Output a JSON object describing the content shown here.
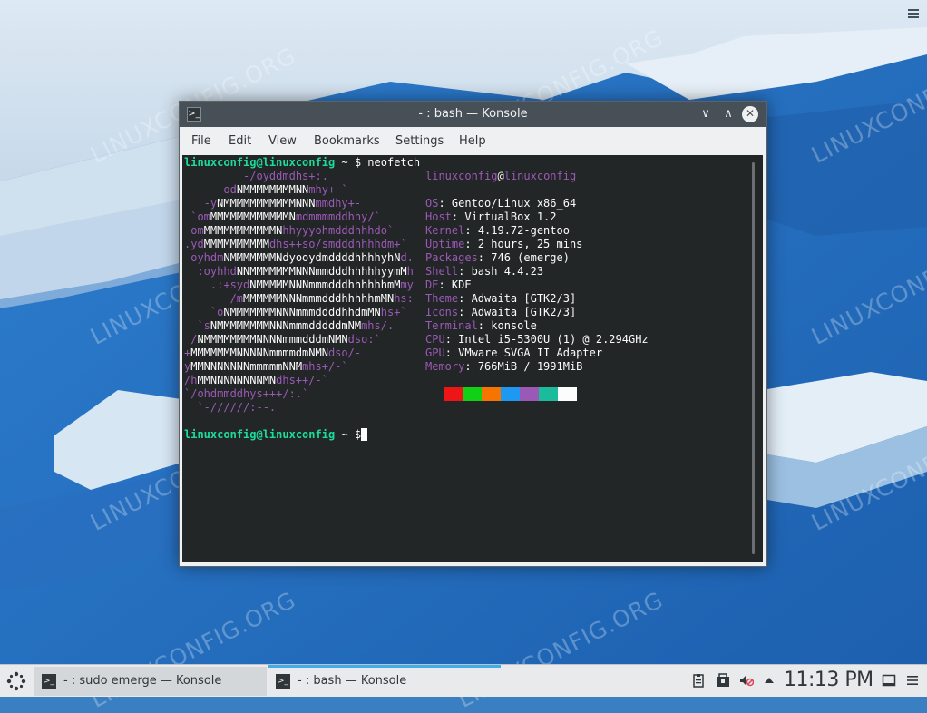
{
  "desktop": {
    "watermark_text": "LINUXCONFIG.ORG",
    "menu_icon": "hamburger-icon"
  },
  "window": {
    "title": "- : bash — Konsole",
    "app_icon": "terminal-icon",
    "buttons": {
      "minimize": "∨",
      "maximize": "∧",
      "close": "✕"
    },
    "menu": [
      "File",
      "Edit",
      "View",
      "Bookmarks",
      "Settings",
      "Help"
    ]
  },
  "terminal": {
    "prompt": "linuxconfig@linuxconfig",
    "prompt_suffix": " ~ $ ",
    "command": "neofetch",
    "logo": [
      "         -/oyddmdhs+:.",
      "     -odNMMMMMMMMNNmhy+-`",
      "   -yNMMMMMMMMMMMNNNmmdhy+-",
      " `omMMMMMMMMMMMMNmdmmmmddhhy/`",
      " omMMMMMMMMMMMNhhyyyohmdddhhhdo`",
      ".ydMMMMMMMMMMdhs++so/smdddhhhhdm+`",
      " oyhdmNMMMMMMMNdyooydmddddhhhhyhNd.",
      "  :oyhhdNNMMMMMMMNNNmmdddhhhhhyymMh",
      "    .:+sydNMMMMMNNNmmmdddhhhhhhmMmy",
      "       /mMMMMMMNNNmmmdddhhhhhmMNhs:",
      "    `oNMMMMMMMNNNmmmddddhhdmMNhs+`",
      "  `sNMMMMMMMMNNNmmmdddddmNMmhs/.",
      " /NMMMMMMMMNNNNmmmdddmNMNdso:`",
      "+MMMMMMMNNNNNmmmmdmNMNdso/-",
      "yMMNNNNNNNmmmmmNNMmhs+/-`",
      "/hMMNNNNNNNNMNdhs++/-`",
      "`/ohdmmddhys+++/:.`",
      "  `-//////:--."
    ],
    "info": {
      "user": "linuxconfig",
      "at": "@",
      "host": "linuxconfig",
      "separator": "-----------------------",
      "rows": [
        {
          "key": "OS",
          "value": "Gentoo/Linux x86_64"
        },
        {
          "key": "Host",
          "value": "VirtualBox 1.2"
        },
        {
          "key": "Kernel",
          "value": "4.19.72-gentoo"
        },
        {
          "key": "Uptime",
          "value": "2 hours, 25 mins"
        },
        {
          "key": "Packages",
          "value": "746 (emerge)"
        },
        {
          "key": "Shell",
          "value": "bash 4.4.23"
        },
        {
          "key": "DE",
          "value": "KDE"
        },
        {
          "key": "Theme",
          "value": "Adwaita [GTK2/3]"
        },
        {
          "key": "Icons",
          "value": "Adwaita [GTK2/3]"
        },
        {
          "key": "Terminal",
          "value": "konsole"
        },
        {
          "key": "CPU",
          "value": "Intel i5-5300U (1) @ 2.294GHz"
        },
        {
          "key": "GPU",
          "value": "VMware SVGA II Adapter"
        },
        {
          "key": "Memory",
          "value": "766MiB / 1991MiB"
        }
      ],
      "palette": [
        "#ed1515",
        "#11d116",
        "#f67400",
        "#1d99f3",
        "#9b59b6",
        "#1abc9c",
        "#fcfcfc"
      ]
    }
  },
  "taskbar": {
    "launcher_icon": "application-launcher-icon",
    "tasks": [
      {
        "label": "- : sudo emerge — Konsole",
        "icon": "terminal-icon"
      },
      {
        "label": "- : bash — Konsole",
        "icon": "terminal-icon"
      }
    ],
    "tray": [
      "clipboard-icon",
      "package-updates-icon",
      "volume-muted-icon",
      "expand-tray-icon"
    ],
    "clock": "11:13 PM",
    "show_desktop_icon": "show-desktop-icon"
  }
}
